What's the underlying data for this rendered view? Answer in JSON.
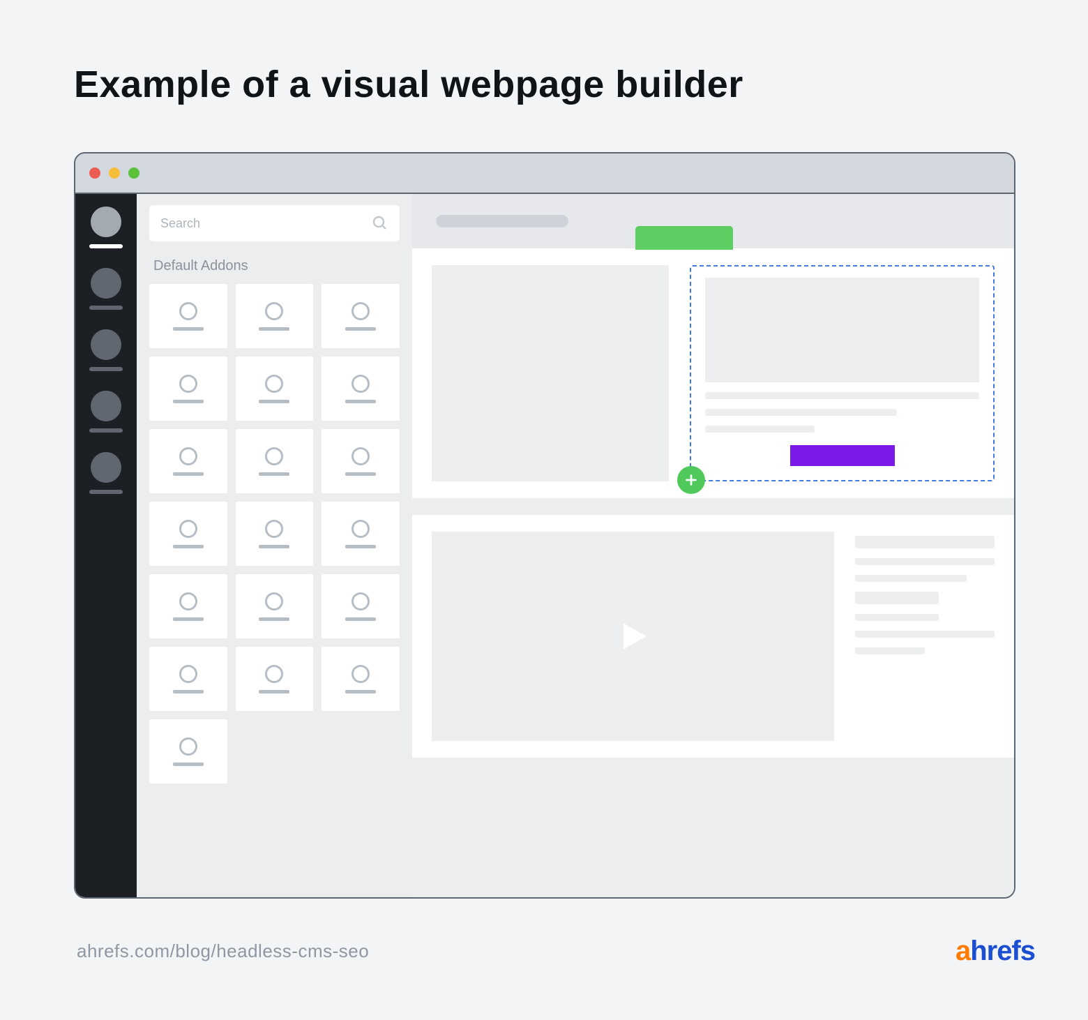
{
  "title": "Example of a visual webpage builder",
  "panel": {
    "search_placeholder": "Search",
    "heading": "Default Addons",
    "addon_count": 19
  },
  "colors": {
    "accent_green": "#5ece62",
    "accent_purple": "#7b1ae8",
    "drop_border": "#3f7be1",
    "add_button": "#4fc95a"
  },
  "footer": {
    "source": "ahrefs.com/blog/headless-cms-seo",
    "brand_first": "a",
    "brand_rest": "hrefs"
  }
}
